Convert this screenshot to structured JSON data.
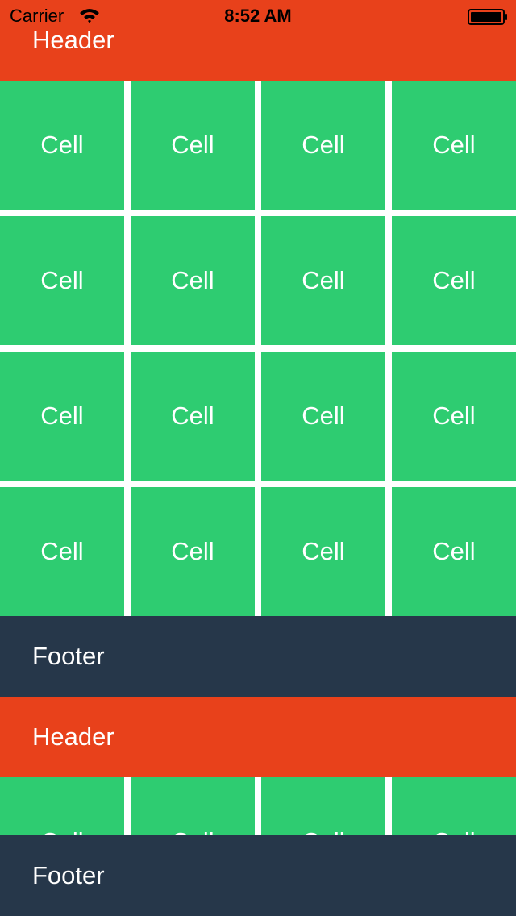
{
  "status_bar": {
    "carrier": "Carrier",
    "time": "8:52 AM",
    "wifi_icon": "wifi-icon",
    "battery_icon": "battery-icon"
  },
  "sections": [
    {
      "header": "Header",
      "footer": "Footer",
      "cells": [
        "Cell",
        "Cell",
        "Cell",
        "Cell",
        "Cell",
        "Cell",
        "Cell",
        "Cell",
        "Cell",
        "Cell",
        "Cell",
        "Cell",
        "Cell",
        "Cell",
        "Cell",
        "Cell"
      ]
    },
    {
      "header": "Header",
      "footer": "Footer",
      "cells": [
        "Cell",
        "Cell",
        "Cell",
        "Cell"
      ]
    }
  ],
  "colors": {
    "header": "#e8411b",
    "footer": "#26374a",
    "cell": "#2ecc71",
    "text": "#ffffff"
  }
}
